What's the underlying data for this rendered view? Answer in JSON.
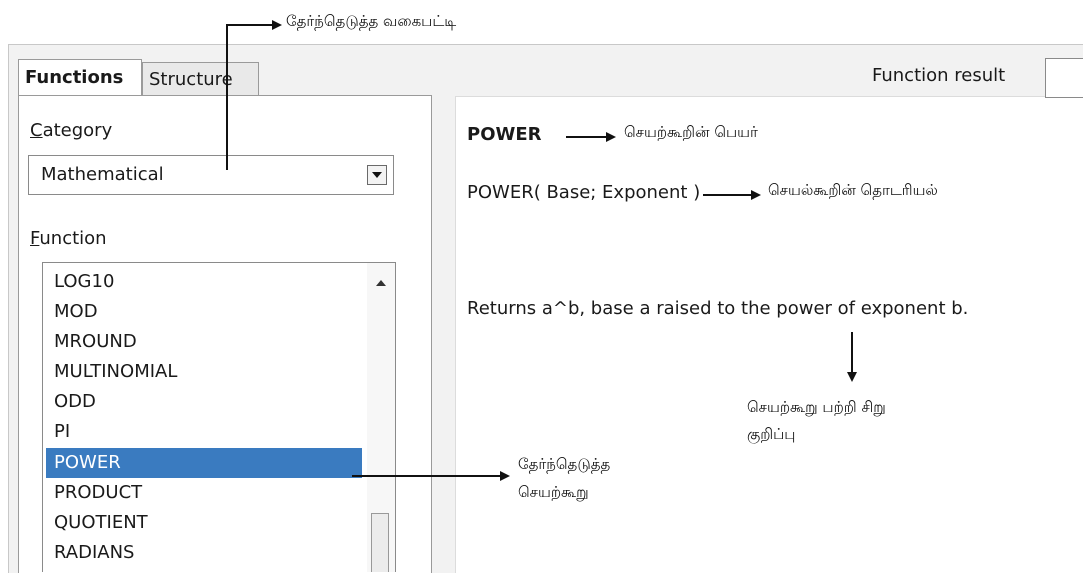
{
  "tabs": {
    "functions": "Functions",
    "structure": "Structure"
  },
  "category": {
    "label_first": "C",
    "label_rest": "ategory",
    "value": "Mathematical"
  },
  "function": {
    "label_first": "F",
    "label_rest": "unction",
    "items": [
      "LOG10",
      "MOD",
      "MROUND",
      "MULTINOMIAL",
      "ODD",
      "PI",
      "POWER",
      "PRODUCT",
      "QUOTIENT",
      "RADIANS"
    ],
    "selected": "POWER"
  },
  "function_result": {
    "label": "Function result",
    "value": ""
  },
  "detail": {
    "name": "POWER",
    "syntax": "POWER( Base; Exponent )",
    "description": "Returns a^b, base a raised to the power of exponent b."
  },
  "annotations": {
    "selected_category": "தேர்ந்தெடுத்த வகைபட்டி",
    "function_name": "செயற்கூறின் பெயர்",
    "function_syntax": "செயல்கூறின் தொடரியல்",
    "function_description_line1": "செயற்கூறு பற்றி சிறு",
    "function_description_line2": "குறிப்பு",
    "selected_function_line1": "தேர்ந்தெடுத்த",
    "selected_function_line2": "செயற்கூறு"
  },
  "colors": {
    "selection": "#3a7bc0",
    "dialog_bg": "#f2f2f2"
  },
  "icons": {
    "combo_arrow": "chevron-down-icon",
    "scroll_up": "chevron-up-icon"
  }
}
